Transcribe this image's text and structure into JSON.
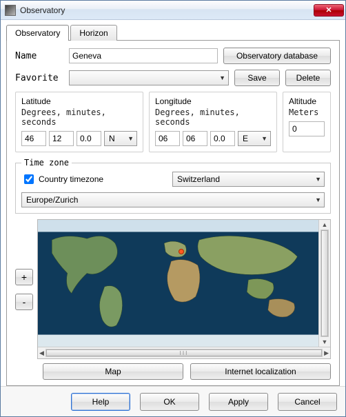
{
  "window": {
    "title": "Observatory"
  },
  "tabs": {
    "observatory": "Observatory",
    "horizon": "Horizon"
  },
  "form": {
    "name_label": "Name",
    "name_value": "Geneva",
    "favorite_label": "Favorite",
    "favorite_value": "",
    "obs_db": "Observatory database",
    "save": "Save",
    "delete": "Delete"
  },
  "coords": {
    "latitude": {
      "title": "Latitude",
      "sub": "Degrees, minutes, seconds",
      "deg": "46",
      "min": "12",
      "sec": "0.0",
      "hemi": "N"
    },
    "longitude": {
      "title": "Longitude",
      "sub": "Degrees, minutes, seconds",
      "deg": "06",
      "min": "06",
      "sec": "0.0",
      "hemi": "E"
    },
    "altitude": {
      "title": "Altitude",
      "sub": "Meters",
      "value": "0"
    }
  },
  "timezone": {
    "group": "Time zone",
    "country_tz_label": "Country timezone",
    "country_tz_checked": true,
    "country": "Switzerland",
    "tz": "Europe/Zurich"
  },
  "map": {
    "zoom_in": "+",
    "zoom_out": "-",
    "map_btn": "Map",
    "internet_btn": "Internet localization",
    "scroll_thumb": "III"
  },
  "dialog": {
    "help": "Help",
    "ok": "OK",
    "apply": "Apply",
    "cancel": "Cancel"
  }
}
